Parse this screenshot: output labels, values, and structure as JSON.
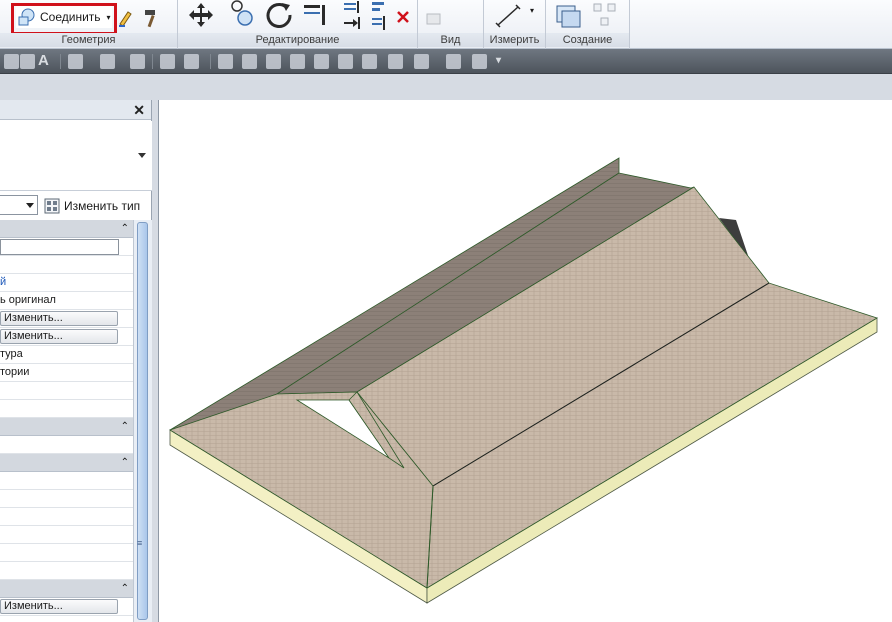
{
  "ribbon": {
    "panels": [
      {
        "label": "Геометрия"
      },
      {
        "label": "Редактирование"
      },
      {
        "label": "Вид"
      },
      {
        "label": "Измерить"
      },
      {
        "label": "Создание"
      }
    ],
    "join_button_label": "Соединить",
    "highlight_color": "#d0111b"
  },
  "quick_toolbar": {
    "text_tool": "A"
  },
  "properties": {
    "edit_type_label": "Изменить тип",
    "rows": [
      {
        "kind": "field",
        "text": ""
      },
      {
        "kind": "text",
        "text": "й"
      },
      {
        "kind": "text",
        "text": "ь оригинал"
      },
      {
        "kind": "button",
        "text": "Изменить..."
      },
      {
        "kind": "button",
        "text": "Изменить..."
      },
      {
        "kind": "text",
        "text": "тура"
      },
      {
        "kind": "text",
        "text": "тории"
      }
    ],
    "bottom_button_label": "Изменить..."
  },
  "colors": {
    "roof_light": "#c9b9a9",
    "roof_dark": "#8c8078",
    "fascia": "#f3f0c4",
    "ridge_line": "#2f5a2a"
  }
}
